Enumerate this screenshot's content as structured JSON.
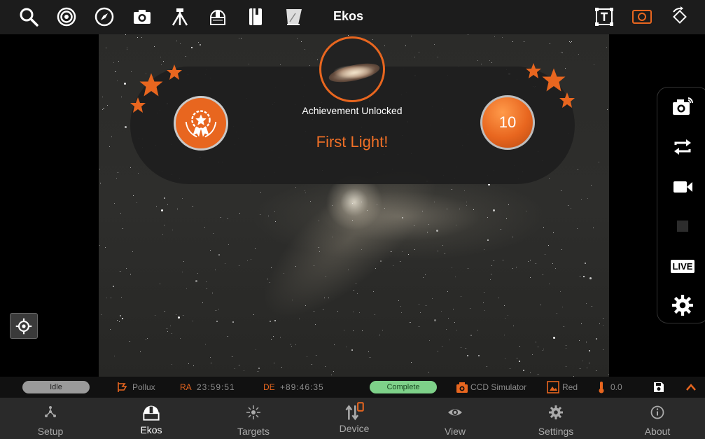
{
  "topbar": {
    "title": "Ekos",
    "icons": [
      "search-icon",
      "target-icon",
      "compass-icon",
      "camera-icon",
      "tripod-icon",
      "dome-icon",
      "notebook-icon",
      "flat-panel-icon",
      "text-overlay-icon",
      "frame-icon",
      "rotate-icon"
    ]
  },
  "achievement": {
    "subtitle": "Achievement Unlocked",
    "title": "First Light!",
    "points": "10"
  },
  "capture_panel": {
    "live_label": "LIVE",
    "icons": [
      "capture-icon",
      "loop-icon",
      "video-icon",
      "stop-icon",
      "live-icon",
      "settings-icon"
    ]
  },
  "status": {
    "mount_state": "Idle",
    "target": "Pollux",
    "ra_label": "RA",
    "ra_value": "23:59:51",
    "de_label": "DE",
    "de_value": "+89:46:35",
    "capture_state": "Complete",
    "camera": "CCD Simulator",
    "filter": "Red",
    "temperature": "0.0"
  },
  "nav": {
    "items": [
      {
        "label": "Setup",
        "icon": "setup-icon"
      },
      {
        "label": "Ekos",
        "icon": "ekos-icon"
      },
      {
        "label": "Targets",
        "icon": "targets-icon"
      },
      {
        "label": "Device",
        "icon": "device-icon"
      },
      {
        "label": "View",
        "icon": "view-icon"
      },
      {
        "label": "Settings",
        "icon": "settings-icon"
      },
      {
        "label": "About",
        "icon": "about-icon"
      }
    ],
    "active": "Ekos"
  },
  "colors": {
    "accent": "#e8661f",
    "idle": "#9a9a9a",
    "complete": "#7ed189",
    "topbar": "#1c1c1c",
    "nav": "#2a2a2a"
  }
}
